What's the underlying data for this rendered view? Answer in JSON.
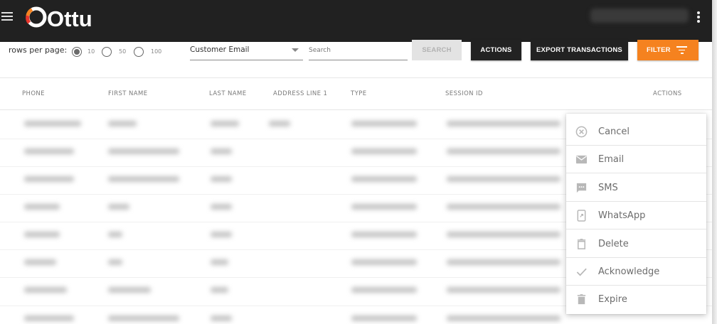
{
  "app": {
    "brand": "Ottu",
    "brand_accent": "#f5821f",
    "topbar_color": "#212121"
  },
  "toolbar": {
    "rows_per_page_label": "rows per page:",
    "rows_options": [
      "10",
      "50",
      "100"
    ],
    "rows_selected": "10",
    "search_field": {
      "value": "Customer Email",
      "options": [
        "Customer Email"
      ]
    },
    "search_input": {
      "placeholder": "Search"
    },
    "search_button": "SEARCH",
    "actions_button": "ACTIONS",
    "export_button": "EXPORT TRANSACTIONS",
    "filter_button": "FILTER"
  },
  "table": {
    "headers": [
      "PHONE",
      "FIRST NAME",
      "LAST NAME",
      "ADDRESS LINE 1",
      "TYPE",
      "SESSION ID",
      "ACTIONS"
    ]
  },
  "actions_menu": {
    "items": [
      {
        "label": "Cancel",
        "icon": "cancel-circle-icon"
      },
      {
        "label": "Email",
        "icon": "email-icon"
      },
      {
        "label": "SMS",
        "icon": "sms-icon"
      },
      {
        "label": "WhatsApp",
        "icon": "whatsapp-icon"
      },
      {
        "label": "Delete",
        "icon": "delete-icon"
      },
      {
        "label": "Acknowledge",
        "icon": "checkmark-icon"
      },
      {
        "label": "Expire",
        "icon": "expire-trash-icon"
      }
    ]
  }
}
